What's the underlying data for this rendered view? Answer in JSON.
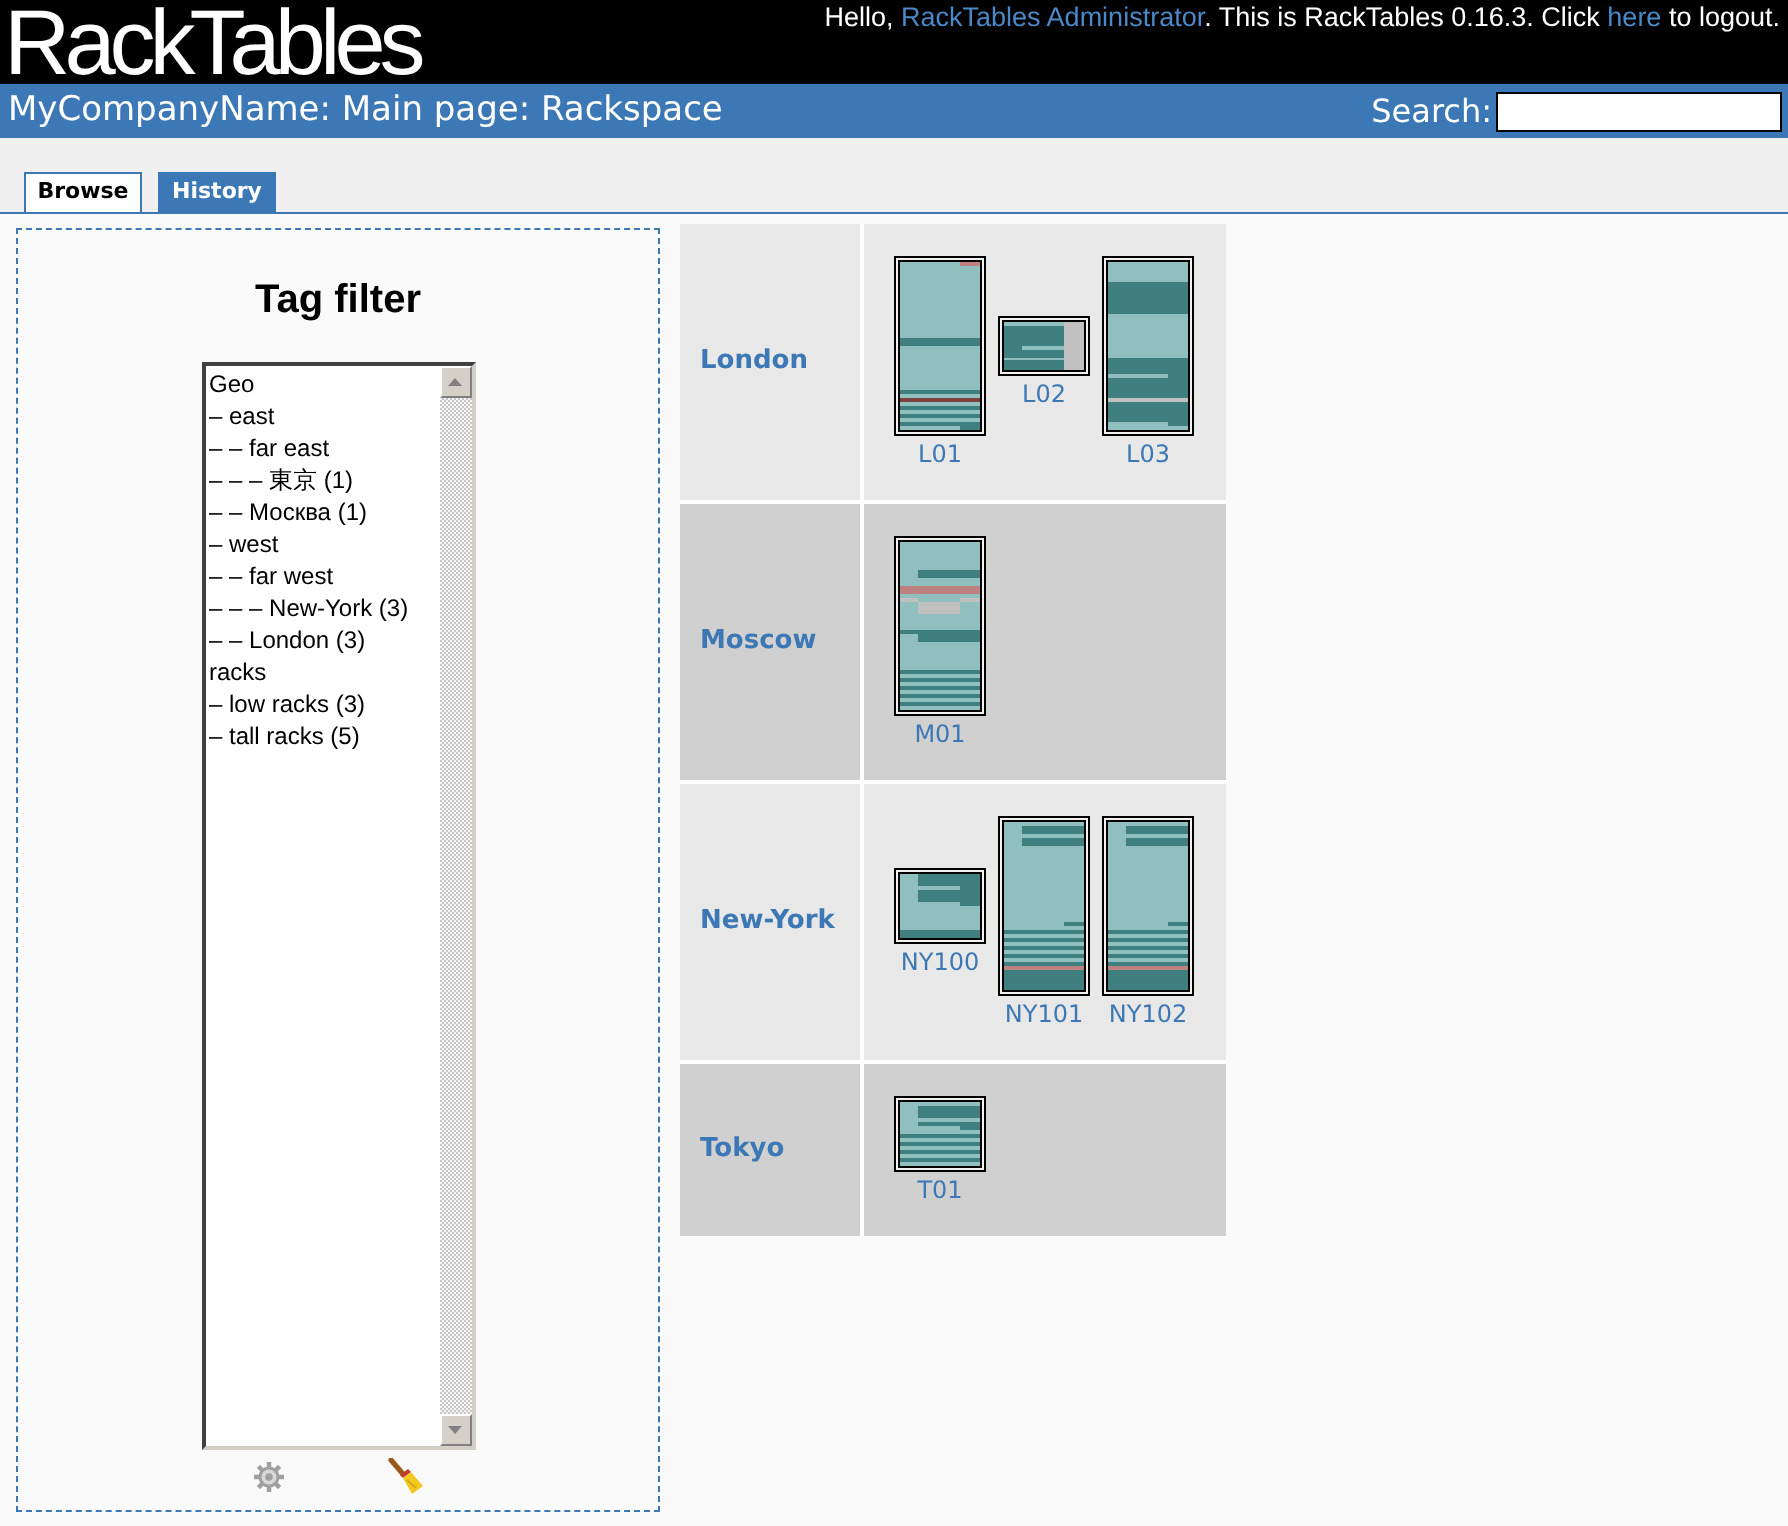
{
  "header": {
    "logo": "RackTables",
    "greeting": [
      {
        "kind": "text",
        "text": "Hello, "
      },
      {
        "kind": "link",
        "text": "RackTables Administrator"
      },
      {
        "kind": "text",
        "text": ". This is RackTables 0.16.3. Click "
      },
      {
        "kind": "link",
        "text": "here"
      },
      {
        "kind": "text",
        "text": " to logout."
      }
    ]
  },
  "path_bar": {
    "title": "MyCompanyName: Main page: Rackspace",
    "search": {
      "label": "Search:"
    }
  },
  "tabs": [
    {
      "label": "Browse",
      "selected": true
    },
    {
      "label": "History",
      "selected": false
    }
  ],
  "tag_filter": {
    "title": "Tag filter",
    "tags": [
      {
        "label": "Geo",
        "selected": false,
        "children": [
          {
            "label": "– east",
            "selected": false,
            "children": [
              {
                "label": "– – far east",
                "selected": false,
                "children": [
                  {
                    "label": "– – – 東京 (1)",
                    "selected": false
                  }
                ]
              },
              {
                "label": "– – Москва (1)",
                "selected": false
              }
            ]
          },
          {
            "label": "– west",
            "selected": false,
            "children": [
              {
                "label": "– – far west",
                "selected": false,
                "children": [
                  {
                    "label": "– – – New-York (3)",
                    "selected": false
                  }
                ]
              },
              {
                "label": "– – London (3)",
                "selected": false
              }
            ]
          }
        ]
      },
      {
        "label": "racks",
        "selected": false,
        "children": [
          {
            "label": "– low racks (3)",
            "selected": false
          },
          {
            "label": "– tall racks (5)",
            "selected": false
          }
        ]
      }
    ]
  },
  "rackspace": [
    {
      "location": "London",
      "racks": [
        {
          "name": "L01"
        },
        {
          "name": "L02"
        },
        {
          "name": "L03"
        }
      ]
    },
    {
      "location": "Moscow",
      "racks": [
        {
          "name": "M01"
        }
      ]
    },
    {
      "location": "New-York",
      "racks": [
        {
          "name": "NY100"
        },
        {
          "name": "NY101"
        },
        {
          "name": "NY102"
        }
      ]
    },
    {
      "location": "Tokyo",
      "racks": [
        {
          "name": "T01"
        }
      ]
    }
  ]
}
